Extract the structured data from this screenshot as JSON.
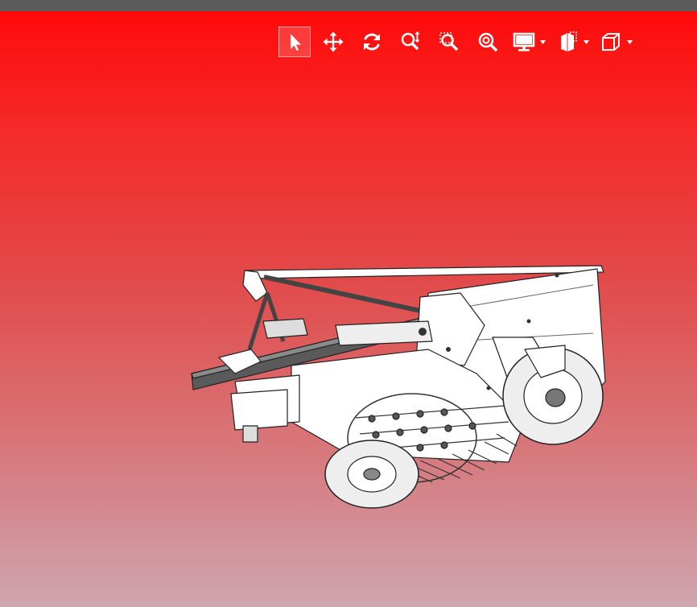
{
  "window": {
    "title_bar_color": "#5c5c5c"
  },
  "viewport": {
    "background_top": "#ff0a0a",
    "background_bottom": "#cfa6b0"
  },
  "toolbar": {
    "tools": [
      {
        "id": "select",
        "icon": "cursor-arrow-icon",
        "active": true
      },
      {
        "id": "pan",
        "icon": "move-arrows-icon",
        "active": false
      },
      {
        "id": "rotate",
        "icon": "rotate-icon",
        "active": false
      },
      {
        "id": "zoom",
        "icon": "zoom-updown-icon",
        "active": false
      },
      {
        "id": "zoom-window",
        "icon": "zoom-window-icon",
        "active": false
      },
      {
        "id": "zoom-fit",
        "icon": "zoom-fit-icon",
        "active": false
      },
      {
        "id": "display",
        "icon": "monitor-icon",
        "has_dropdown": true
      },
      {
        "id": "section",
        "icon": "section-view-icon",
        "has_dropdown": true
      },
      {
        "id": "view-orientation",
        "icon": "cube-view-icon",
        "has_dropdown": true
      }
    ]
  },
  "model": {
    "description_icon": "hay-rake-machine-model",
    "body_color": "#ffffff",
    "frame_color": "#555555"
  }
}
